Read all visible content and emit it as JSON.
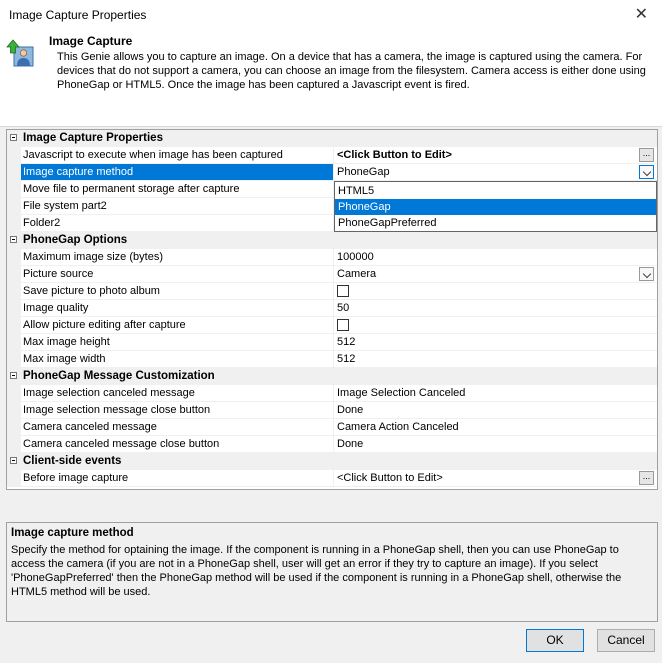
{
  "window": {
    "title": "Image Capture Properties"
  },
  "header": {
    "title": "Image Capture",
    "description": "This Genie allows you to capture an image. On a device that has a camera, the image is captured using the camera. For devices that do not support a camera, you can choose an image from the filesystem. Camera access is either done using PhoneGap or HTML5. Once the image has been captured a Javascript event is fired."
  },
  "grid": {
    "cat1": {
      "label": "Image Capture Properties",
      "rows": [
        {
          "name": "Javascript to execute when image has been captured",
          "value": "<Click Button to Edit>"
        },
        {
          "name": "Image capture method",
          "value": "PhoneGap"
        },
        {
          "name": "Move file to permanent storage after capture",
          "value": ""
        },
        {
          "name": "File system part2",
          "value": ""
        },
        {
          "name": "Folder2",
          "value": ""
        }
      ]
    },
    "dropdown_options": [
      "HTML5",
      "PhoneGap",
      "PhoneGapPreferred"
    ],
    "dropdown_selected": "PhoneGap",
    "cat2": {
      "label": "PhoneGap Options",
      "rows": [
        {
          "name": "Maximum image size (bytes)",
          "value": "100000"
        },
        {
          "name": "Picture source",
          "value": "Camera"
        },
        {
          "name": "Save picture to photo album",
          "value": ""
        },
        {
          "name": "Image quality",
          "value": "50"
        },
        {
          "name": "Allow picture editing after capture",
          "value": ""
        },
        {
          "name": "Max image height",
          "value": "512"
        },
        {
          "name": "Max image width",
          "value": "512"
        }
      ]
    },
    "cat3": {
      "label": "PhoneGap Message Customization",
      "rows": [
        {
          "name": "Image selection canceled message",
          "value": "Image Selection Canceled"
        },
        {
          "name": "Image selection message close button",
          "value": "Done"
        },
        {
          "name": "Camera canceled message",
          "value": "Camera Action Canceled"
        },
        {
          "name": "Camera canceled message close button",
          "value": "Done"
        }
      ]
    },
    "cat4": {
      "label": "Client-side events",
      "rows": [
        {
          "name": "Before image capture",
          "value": "<Click Button to Edit>"
        }
      ]
    }
  },
  "help": {
    "title": "Image capture method",
    "text": "Specify the method for optaining the image. If the component is running in a PhoneGap shell, then you can use PhoneGap to access the camera (if you are not in a PhoneGap shell, user will get an error if they try to capture an image). If you select 'PhoneGapPreferred' then the PhoneGap method will be used if the component is running in a PhoneGap shell, otherwise the HTML5 method will be used."
  },
  "buttons": {
    "ok": "OK",
    "cancel": "Cancel"
  },
  "colors": {
    "selection": "#0078d7",
    "category_bg": "#f0f0f0"
  },
  "icons": {
    "header": "user-upload-icon",
    "close": "close-icon",
    "ellipsis": "ellipsis-icon",
    "dropdown": "chevron-down-icon"
  }
}
